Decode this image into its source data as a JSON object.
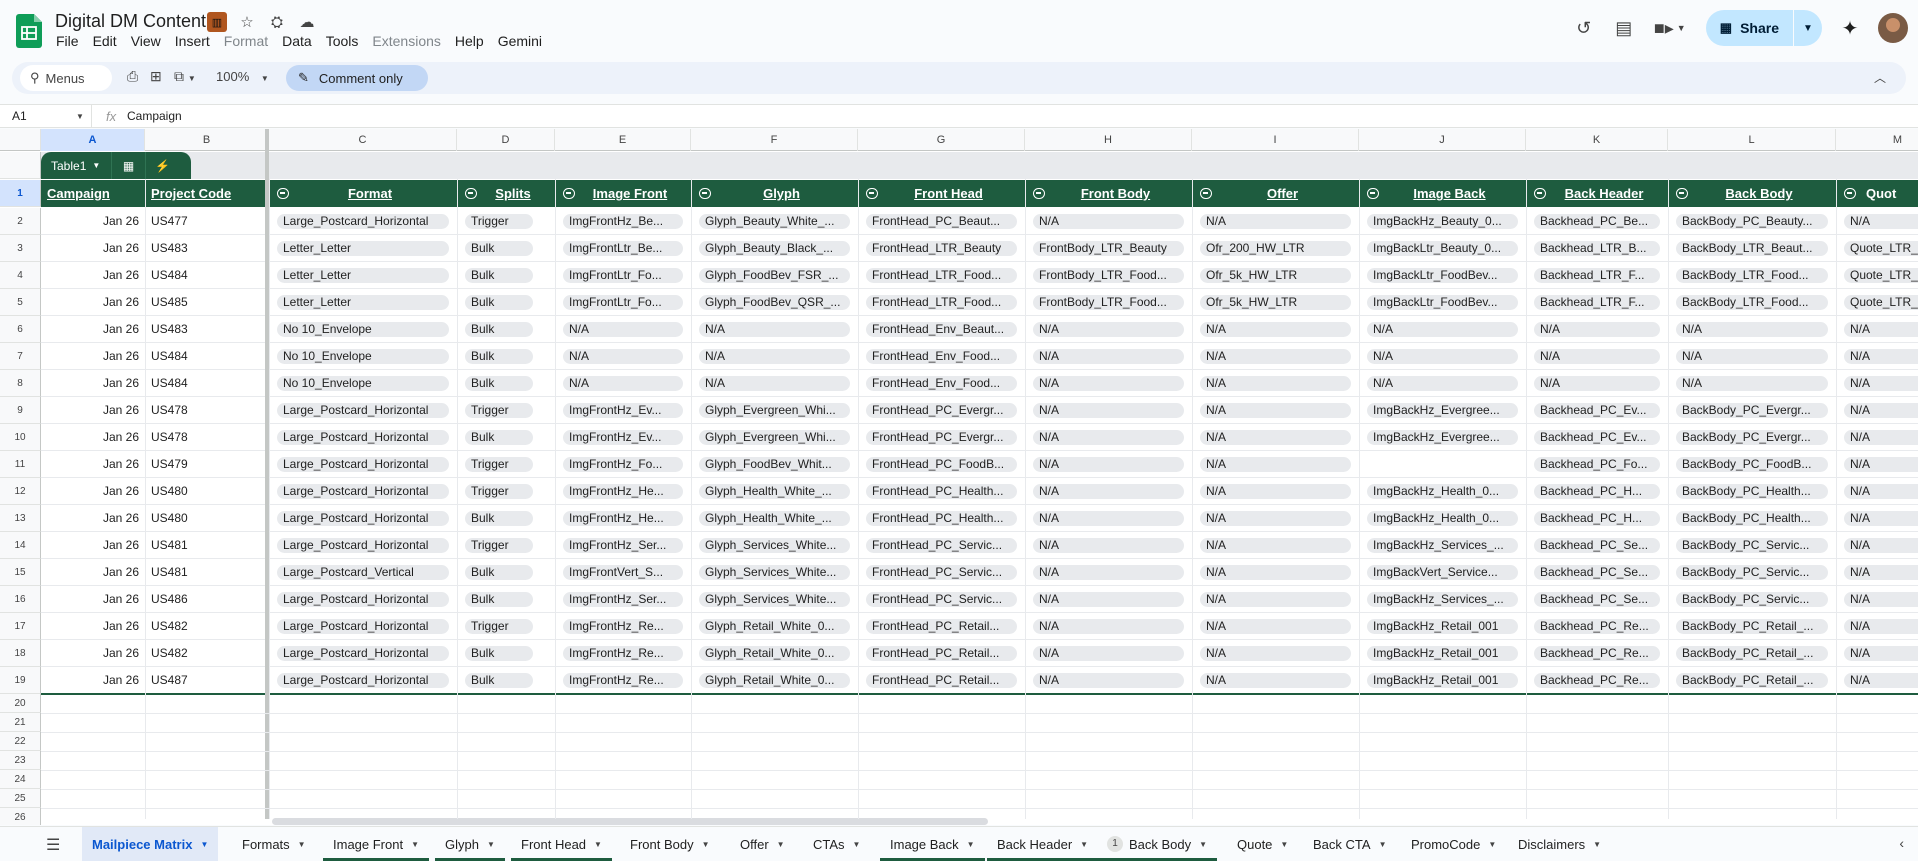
{
  "app": {
    "title": "Digital DM Content",
    "menus": [
      "File",
      "Edit",
      "View",
      "Insert",
      "Format",
      "Data",
      "Tools",
      "Extensions",
      "Help",
      "Gemini"
    ],
    "disabled_menus": [
      "Format",
      "Extensions"
    ],
    "share_label": "Share"
  },
  "toolbar": {
    "menus_label": "Menus",
    "zoom": "100%",
    "mode_label": "Comment only"
  },
  "formula": {
    "cell_ref": "A1",
    "fx": "fx",
    "value": "Campaign"
  },
  "grid": {
    "column_letters": [
      "A",
      "B",
      "C",
      "D",
      "E",
      "F",
      "G",
      "H",
      "I",
      "J",
      "K",
      "L",
      "M"
    ],
    "row_numbers": [
      "1",
      "2",
      "3",
      "4",
      "5",
      "6",
      "7",
      "8",
      "9",
      "10",
      "11",
      "12",
      "13",
      "14",
      "15",
      "16",
      "17",
      "18",
      "19",
      "20",
      "21",
      "22",
      "23",
      "24",
      "25",
      "26"
    ],
    "table_name": "Table1",
    "headers": [
      "Campaign",
      "Project Code",
      "Format",
      "Splits",
      "Image Front",
      "Glyph",
      "Front Head",
      "Front Body",
      "Offer",
      "Image Back",
      "Back Header",
      "Back Body",
      "Quot"
    ],
    "rows": [
      [
        "Jan 26",
        "US477",
        "Large_Postcard_Horizontal",
        "Trigger",
        "ImgFrontHz_Be...",
        "Glyph_Beauty_White_...",
        "FrontHead_PC_Beaut...",
        "N/A",
        "N/A",
        "ImgBackHz_Beauty_0...",
        "Backhead_PC_Be...",
        "BackBody_PC_Beauty...",
        "N/A"
      ],
      [
        "Jan 26",
        "US483",
        "Letter_Letter",
        "Bulk",
        "ImgFrontLtr_Be...",
        "Glyph_Beauty_Black_...",
        "FrontHead_LTR_Beauty",
        "FrontBody_LTR_Beauty",
        "Ofr_200_HW_LTR",
        "ImgBackLtr_Beauty_0...",
        "Backhead_LTR_B...",
        "BackBody_LTR_Beaut...",
        "Quote_LTR_"
      ],
      [
        "Jan 26",
        "US484",
        "Letter_Letter",
        "Bulk",
        "ImgFrontLtr_Fo...",
        "Glyph_FoodBev_FSR_...",
        "FrontHead_LTR_Food...",
        "FrontBody_LTR_Food...",
        "Ofr_5k_HW_LTR",
        "ImgBackLtr_FoodBev...",
        "Backhead_LTR_F...",
        "BackBody_LTR_Food...",
        "Quote_LTR_"
      ],
      [
        "Jan 26",
        "US485",
        "Letter_Letter",
        "Bulk",
        "ImgFrontLtr_Fo...",
        "Glyph_FoodBev_QSR_...",
        "FrontHead_LTR_Food...",
        "FrontBody_LTR_Food...",
        "Ofr_5k_HW_LTR",
        "ImgBackLtr_FoodBev...",
        "Backhead_LTR_F...",
        "BackBody_LTR_Food...",
        "Quote_LTR_"
      ],
      [
        "Jan 26",
        "US483",
        "No 10_Envelope",
        "Bulk",
        "N/A",
        "N/A",
        "FrontHead_Env_Beaut...",
        "N/A",
        "N/A",
        "N/A",
        "N/A",
        "N/A",
        "N/A"
      ],
      [
        "Jan 26",
        "US484",
        "No 10_Envelope",
        "Bulk",
        "N/A",
        "N/A",
        "FrontHead_Env_Food...",
        "N/A",
        "N/A",
        "N/A",
        "N/A",
        "N/A",
        "N/A"
      ],
      [
        "Jan 26",
        "US484",
        "No 10_Envelope",
        "Bulk",
        "N/A",
        "N/A",
        "FrontHead_Env_Food...",
        "N/A",
        "N/A",
        "N/A",
        "N/A",
        "N/A",
        "N/A"
      ],
      [
        "Jan 26",
        "US478",
        "Large_Postcard_Horizontal",
        "Trigger",
        "ImgFrontHz_Ev...",
        "Glyph_Evergreen_Whi...",
        "FrontHead_PC_Evergr...",
        "N/A",
        "N/A",
        "ImgBackHz_Evergree...",
        "Backhead_PC_Ev...",
        "BackBody_PC_Evergr...",
        "N/A"
      ],
      [
        "Jan 26",
        "US478",
        "Large_Postcard_Horizontal",
        "Bulk",
        "ImgFrontHz_Ev...",
        "Glyph_Evergreen_Whi...",
        "FrontHead_PC_Evergr...",
        "N/A",
        "N/A",
        "ImgBackHz_Evergree...",
        "Backhead_PC_Ev...",
        "BackBody_PC_Evergr...",
        "N/A"
      ],
      [
        "Jan 26",
        "US479",
        "Large_Postcard_Horizontal",
        "Trigger",
        "ImgFrontHz_Fo...",
        "Glyph_FoodBev_Whit...",
        "FrontHead_PC_FoodB...",
        "N/A",
        "N/A",
        "",
        "Backhead_PC_Fo...",
        "BackBody_PC_FoodB...",
        "N/A"
      ],
      [
        "Jan 26",
        "US480",
        "Large_Postcard_Horizontal",
        "Trigger",
        "ImgFrontHz_He...",
        "Glyph_Health_White_...",
        "FrontHead_PC_Health...",
        "N/A",
        "N/A",
        "ImgBackHz_Health_0...",
        "Backhead_PC_H...",
        "BackBody_PC_Health...",
        "N/A"
      ],
      [
        "Jan 26",
        "US480",
        "Large_Postcard_Horizontal",
        "Bulk",
        "ImgFrontHz_He...",
        "Glyph_Health_White_...",
        "FrontHead_PC_Health...",
        "N/A",
        "N/A",
        "ImgBackHz_Health_0...",
        "Backhead_PC_H...",
        "BackBody_PC_Health...",
        "N/A"
      ],
      [
        "Jan 26",
        "US481",
        "Large_Postcard_Horizontal",
        "Trigger",
        "ImgFrontHz_Ser...",
        "Glyph_Services_White...",
        "FrontHead_PC_Servic...",
        "N/A",
        "N/A",
        "ImgBackHz_Services_...",
        "Backhead_PC_Se...",
        "BackBody_PC_Servic...",
        "N/A"
      ],
      [
        "Jan 26",
        "US481",
        "Large_Postcard_Vertical",
        "Bulk",
        "ImgFrontVert_S...",
        "Glyph_Services_White...",
        "FrontHead_PC_Servic...",
        "N/A",
        "N/A",
        "ImgBackVert_Service...",
        "Backhead_PC_Se...",
        "BackBody_PC_Servic...",
        "N/A"
      ],
      [
        "Jan 26",
        "US486",
        "Large_Postcard_Horizontal",
        "Bulk",
        "ImgFrontHz_Ser...",
        "Glyph_Services_White...",
        "FrontHead_PC_Servic...",
        "N/A",
        "N/A",
        "ImgBackHz_Services_...",
        "Backhead_PC_Se...",
        "BackBody_PC_Servic...",
        "N/A"
      ],
      [
        "Jan 26",
        "US482",
        "Large_Postcard_Horizontal",
        "Trigger",
        "ImgFrontHz_Re...",
        "Glyph_Retail_White_0...",
        "FrontHead_PC_Retail...",
        "N/A",
        "N/A",
        "ImgBackHz_Retail_001",
        "Backhead_PC_Re...",
        "BackBody_PC_Retail_...",
        "N/A"
      ],
      [
        "Jan 26",
        "US482",
        "Large_Postcard_Horizontal",
        "Bulk",
        "ImgFrontHz_Re...",
        "Glyph_Retail_White_0...",
        "FrontHead_PC_Retail...",
        "N/A",
        "N/A",
        "ImgBackHz_Retail_001",
        "Backhead_PC_Re...",
        "BackBody_PC_Retail_...",
        "N/A"
      ],
      [
        "Jan 26",
        "US487",
        "Large_Postcard_Horizontal",
        "Bulk",
        "ImgFrontHz_Re...",
        "Glyph_Retail_White_0...",
        "FrontHead_PC_Retail...",
        "N/A",
        "N/A",
        "ImgBackHz_Retail_001",
        "Backhead_PC_Re...",
        "BackBody_PC_Retail_...",
        "N/A"
      ]
    ]
  },
  "sheets": {
    "tabs": [
      "Mailpiece Matrix",
      "Formats",
      "Image Front",
      "Glyph",
      "Front Head",
      "Front Body",
      "Offer",
      "CTAs",
      "Image Back",
      "Back Header",
      "Back Body",
      "Quote",
      "Back CTA",
      "PromoCode",
      "Disclaimers"
    ],
    "active": "Mailpiece Matrix",
    "back_body_badge": "1"
  },
  "colors": {
    "table_header": "#1e5c3f",
    "accent": "#0b57d0",
    "share_bg": "#c2e7ff"
  }
}
